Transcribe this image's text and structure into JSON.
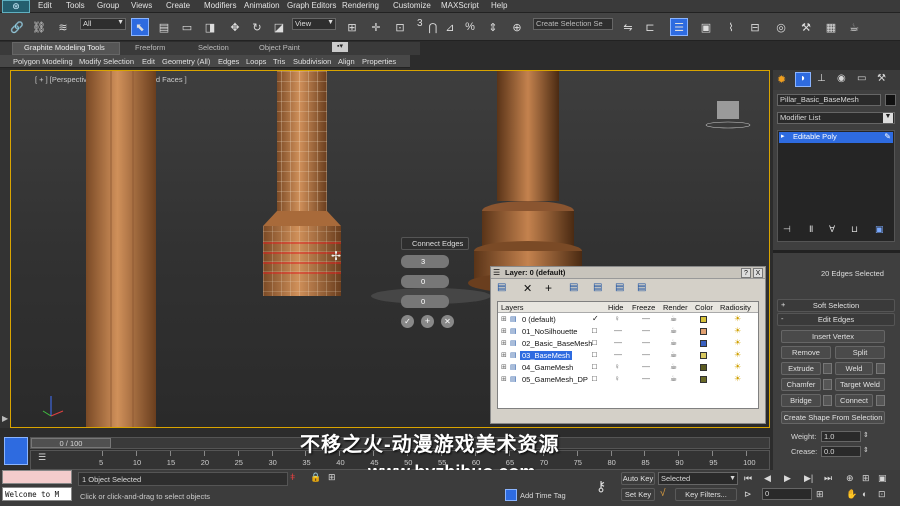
{
  "menu": [
    "Edit",
    "Tools",
    "Group",
    "Views",
    "Create",
    "Modifiers",
    "Animation",
    "Graph Editors",
    "Rendering",
    "Customize",
    "MAXScript",
    "Help"
  ],
  "toolbar": {
    "filter_value": "All",
    "view_value": "View",
    "count_label": "3",
    "selection_set_placeholder": "Create Selection Se"
  },
  "ribbon": {
    "tabs": [
      "Graphite Modeling Tools",
      "Freeform",
      "Selection",
      "Object Paint"
    ],
    "items": [
      "Polygon Modeling",
      "Modify Selection",
      "Edit",
      "Geometry (All)",
      "Edges",
      "Loops",
      "Tris",
      "Subdivision",
      "Align",
      "Properties"
    ]
  },
  "viewport": {
    "label": "[ + ] [Perspective ] [ Realistic + Edged Faces ]"
  },
  "caddy": {
    "title": "Connect Edges",
    "segments": "3",
    "pinch": "0",
    "slide": "0"
  },
  "layer_dialog": {
    "title": "Layer: 0 (default)",
    "help": "?",
    "close": "X",
    "columns": [
      "Layers",
      "Hide",
      "Freeze",
      "Render",
      "Color",
      "Radiosity"
    ],
    "rows": [
      {
        "name": "0 (default)",
        "color": "#d6c23a",
        "active": true,
        "selected": false
      },
      {
        "name": "01_NoSilhouette",
        "color": "#e0a070",
        "active": false,
        "selected": false
      },
      {
        "name": "02_Basic_BaseMesh",
        "color": "#3860c0",
        "active": false,
        "selected": false
      },
      {
        "name": "03_BaseMesh",
        "color": "#d8c860",
        "active": false,
        "selected": true
      },
      {
        "name": "04_GameMesh",
        "color": "#5a5a20",
        "active": false,
        "selected": false
      },
      {
        "name": "05_GameMesh_DP",
        "color": "#6a6a28",
        "active": false,
        "selected": false
      }
    ]
  },
  "command_panel": {
    "object_name": "Pillar_Basic_BaseMesh",
    "modifier_list": "Modifier List",
    "stack_item": "Editable Poly",
    "selection_info": "20 Edges Selected",
    "soft_selection": "Soft Selection",
    "edit_edges": "Edit Edges",
    "insert_vertex": "Insert Vertex",
    "remove": "Remove",
    "split": "Split",
    "extrude": "Extrude",
    "weld": "Weld",
    "chamfer": "Chamfer",
    "target_weld": "Target Weld",
    "bridge": "Bridge",
    "connect": "Connect",
    "create_shape": "Create Shape From Selection",
    "weight_label": "Weight:",
    "weight_value": "1.0",
    "crease_label": "Crease:",
    "crease_value": "0.0"
  },
  "timeline": {
    "frame": "0 / 100",
    "ticks": [
      "5",
      "10",
      "15",
      "20",
      "25",
      "30",
      "35",
      "40",
      "45",
      "50",
      "55",
      "60",
      "65",
      "70",
      "75",
      "80",
      "85",
      "90",
      "95",
      "100"
    ]
  },
  "status": {
    "welcome": "Welcome to M",
    "objects_selected": "1 Object Selected",
    "prompt": "Click or click-and-drag to select objects",
    "add_time_tag": "Add Time Tag",
    "auto_key": "Auto Key",
    "set_key": "Set Key",
    "key_mode": "Selected",
    "key_filters": "Key Filters...",
    "frame_value": "0"
  },
  "watermark": {
    "line1": "不移之火-动漫游戏美术资源",
    "line2": "www.byzhihuo.com"
  },
  "colors": {
    "viewport_border": "#d9a400",
    "selection_blue": "#2e6be0",
    "wood": "#c07a48"
  }
}
